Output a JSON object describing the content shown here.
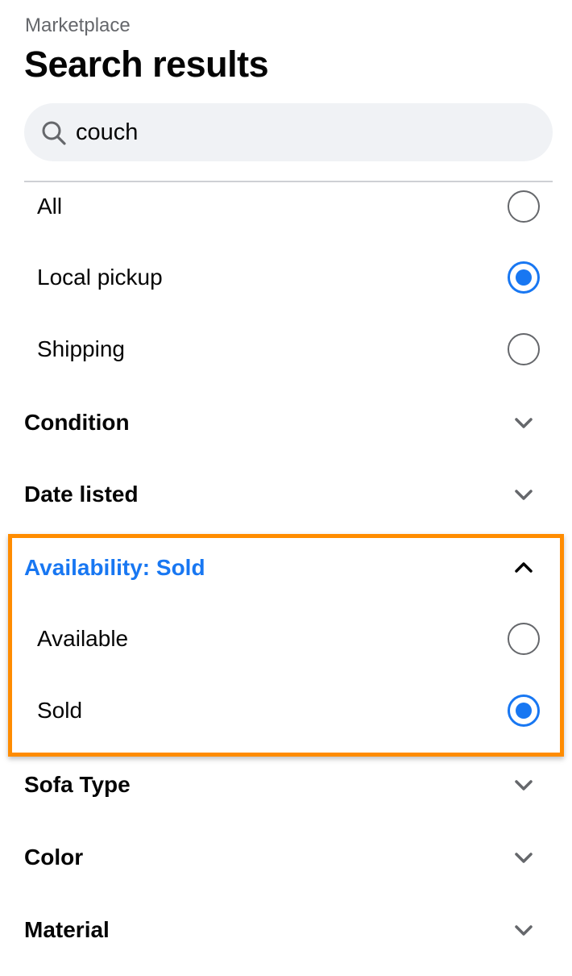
{
  "header": {
    "breadcrumb": "Marketplace",
    "title": "Search results"
  },
  "search": {
    "value": "couch",
    "icon": "search-icon"
  },
  "delivery_options": [
    {
      "label": "All",
      "selected": false
    },
    {
      "label": "Local pickup",
      "selected": true
    },
    {
      "label": "Shipping",
      "selected": false
    }
  ],
  "sections": {
    "condition": {
      "label": "Condition",
      "expanded": false
    },
    "date_listed": {
      "label": "Date listed",
      "expanded": false
    },
    "availability": {
      "label": "Availability: Sold",
      "expanded": true
    },
    "sofa_type": {
      "label": "Sofa Type",
      "expanded": false
    },
    "color": {
      "label": "Color",
      "expanded": false
    },
    "material": {
      "label": "Material",
      "expanded": false
    }
  },
  "availability_options": [
    {
      "label": "Available",
      "selected": false
    },
    {
      "label": "Sold",
      "selected": true
    }
  ],
  "colors": {
    "accent": "#1877f2",
    "highlight": "#ff8c00",
    "muted_text": "#65676b",
    "search_bg": "#f0f2f5"
  }
}
